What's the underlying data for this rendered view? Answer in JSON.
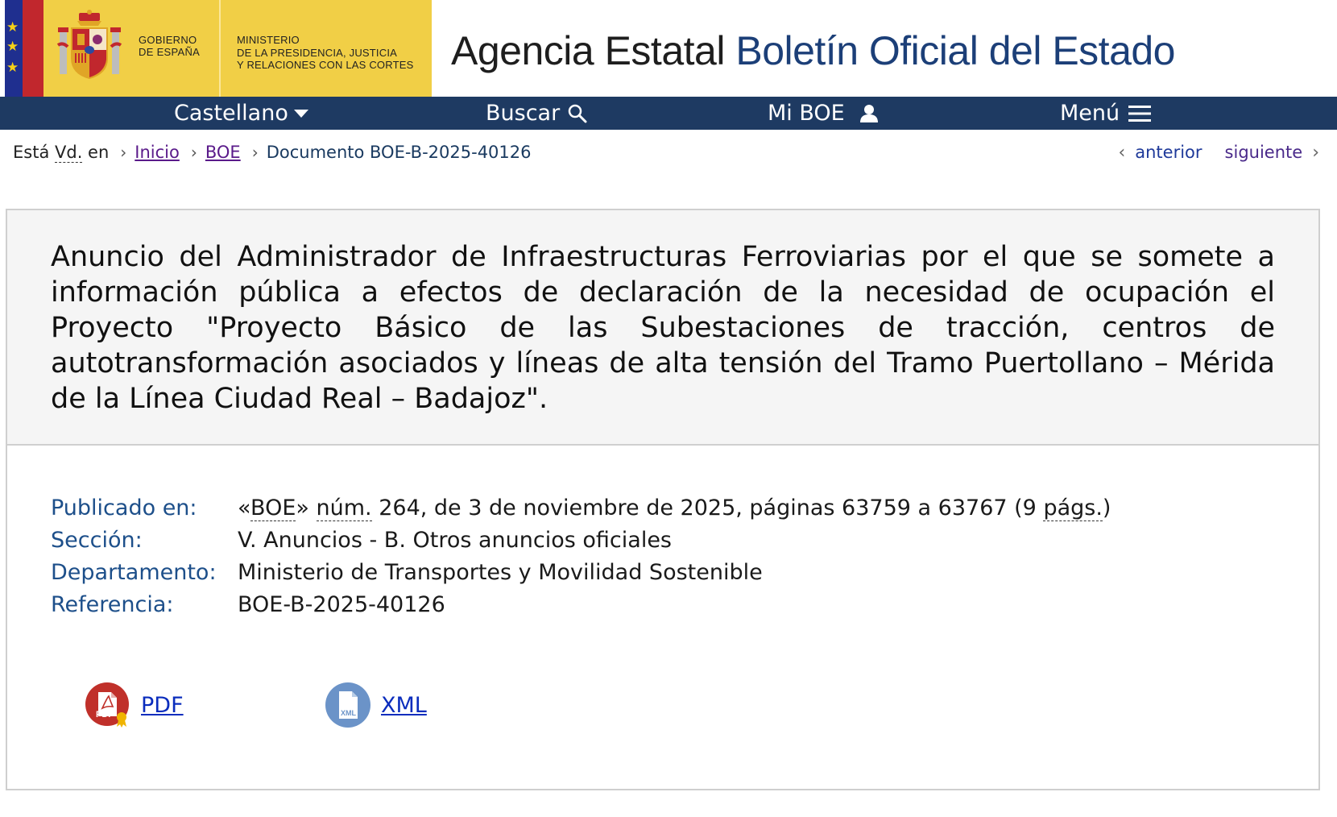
{
  "header": {
    "gov_line1": "Gobierno",
    "gov_line2": "de España",
    "ministry_line1": "Ministerio",
    "ministry_line2": "de la Presidencia, Justicia",
    "ministry_line3": "y Relaciones con las Cortes",
    "site_title_prefix": "Agencia Estatal",
    "site_title_main": "Boletín Oficial del Estado"
  },
  "nav": {
    "language": "Castellano",
    "search": "Buscar",
    "my_boe": "Mi BOE",
    "menu": "Menú"
  },
  "breadcrumb": {
    "prefix_a": "Está ",
    "prefix_abbr": "Vd.",
    "prefix_b": " en",
    "home": "Inicio",
    "boe": "BOE",
    "current": "Documento BOE-B-2025-40126",
    "prev": "anterior",
    "next": "siguiente"
  },
  "document": {
    "title": "Anuncio del Administrador de Infraestructuras Ferroviarias por el que se somete a información pública a efectos de declaración de la necesidad de ocupación el Proyecto \"Proyecto Básico de las Subestaciones de tracción, centros de autotransformación asociados y líneas de alta tensión del Tramo Puertollano – Mérida de la Línea Ciudad Real – Badajoz\".",
    "meta": {
      "published_label": "Publicado en:",
      "published_q1": "«",
      "published_boe": "BOE",
      "published_q2": "» ",
      "published_num": "núm.",
      "published_mid": " 264, de 3 de noviembre de 2025, páginas 63759 a 63767 (9 ",
      "published_pags": "págs.",
      "published_end": ")",
      "section_label": "Sección:",
      "section_value": "V. Anuncios - B. Otros anuncios oficiales",
      "department_label": "Departamento:",
      "department_value": "Ministerio de Transportes y Movilidad Sostenible",
      "reference_label": "Referencia:",
      "reference_value": "BOE-B-2025-40126"
    },
    "downloads": {
      "pdf_label": "PDF",
      "pdf_icon_text": "PDF",
      "xml_label": "XML",
      "xml_icon_text": "XML"
    }
  },
  "colors": {
    "nav_bg": "#1e3a62",
    "gov_yellow": "#f1cf46",
    "title_blue": "#1c3f78",
    "meta_label": "#1d4f8a",
    "link": "#0b2dbd",
    "pdf_red": "#c0302a",
    "xml_blue": "#6b93c8"
  }
}
